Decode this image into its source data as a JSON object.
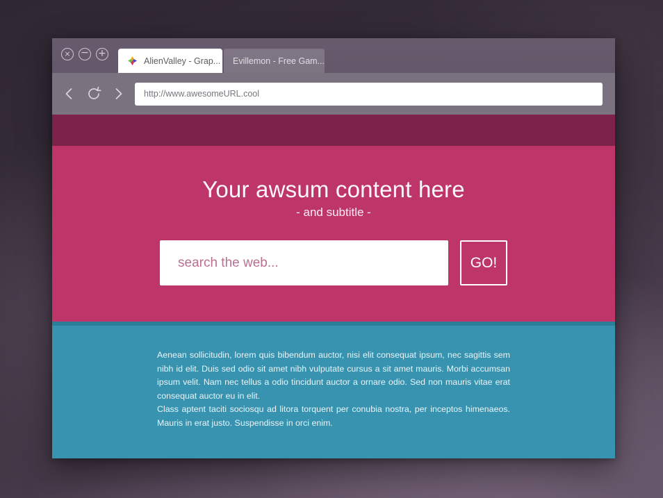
{
  "window": {
    "controls": [
      {
        "name": "close",
        "glyph": "×"
      },
      {
        "name": "minimize",
        "glyph": "−"
      },
      {
        "name": "maximize",
        "glyph": "+"
      }
    ],
    "tabs": [
      {
        "title": "AlienValley - Grap...",
        "active": true,
        "favicon": "alienvalley-star-icon"
      },
      {
        "title": "Evillemon - Free Gam...",
        "active": false,
        "favicon": "none"
      }
    ]
  },
  "navigation": {
    "back_icon": "back-arrow-icon",
    "reload_icon": "reload-icon",
    "forward_icon": "forward-arrow-icon",
    "url_value": "http://www.awesomeURL.cool",
    "url_placeholder": "http://www.awesomeURL.cool"
  },
  "hero": {
    "title": "Your awsum content here",
    "subtitle": "- and subtitle -",
    "search_placeholder": "search the web...",
    "search_value": "",
    "go_label": "GO!"
  },
  "body": {
    "paragraph1": "Aenean sollicitudin, lorem quis bibendum auctor, nisi elit consequat ipsum, nec sagittis sem nibh id elit. Duis sed odio sit amet nibh vulputate cursus a sit amet mauris. Morbi accumsan ipsum velit. Nam nec tellus a odio tincidunt auctor a ornare odio. Sed non  mauris vitae erat consequat auctor eu in elit.",
    "paragraph2": "Class aptent taciti sociosqu ad litora torquent per conubia nostra, per inceptos himenaeos. Mauris in erat justo. Suspendisse in orci enim."
  },
  "colors": {
    "accent_dark_pink": "#7d2349",
    "accent_pink": "#be3669",
    "accent_teal": "#3793af",
    "accent_teal_dark": "#2b7f99",
    "chrome_titlebar": "#675c6d",
    "chrome_navbar": "#7b7280",
    "desktop_background": "#332a36"
  }
}
